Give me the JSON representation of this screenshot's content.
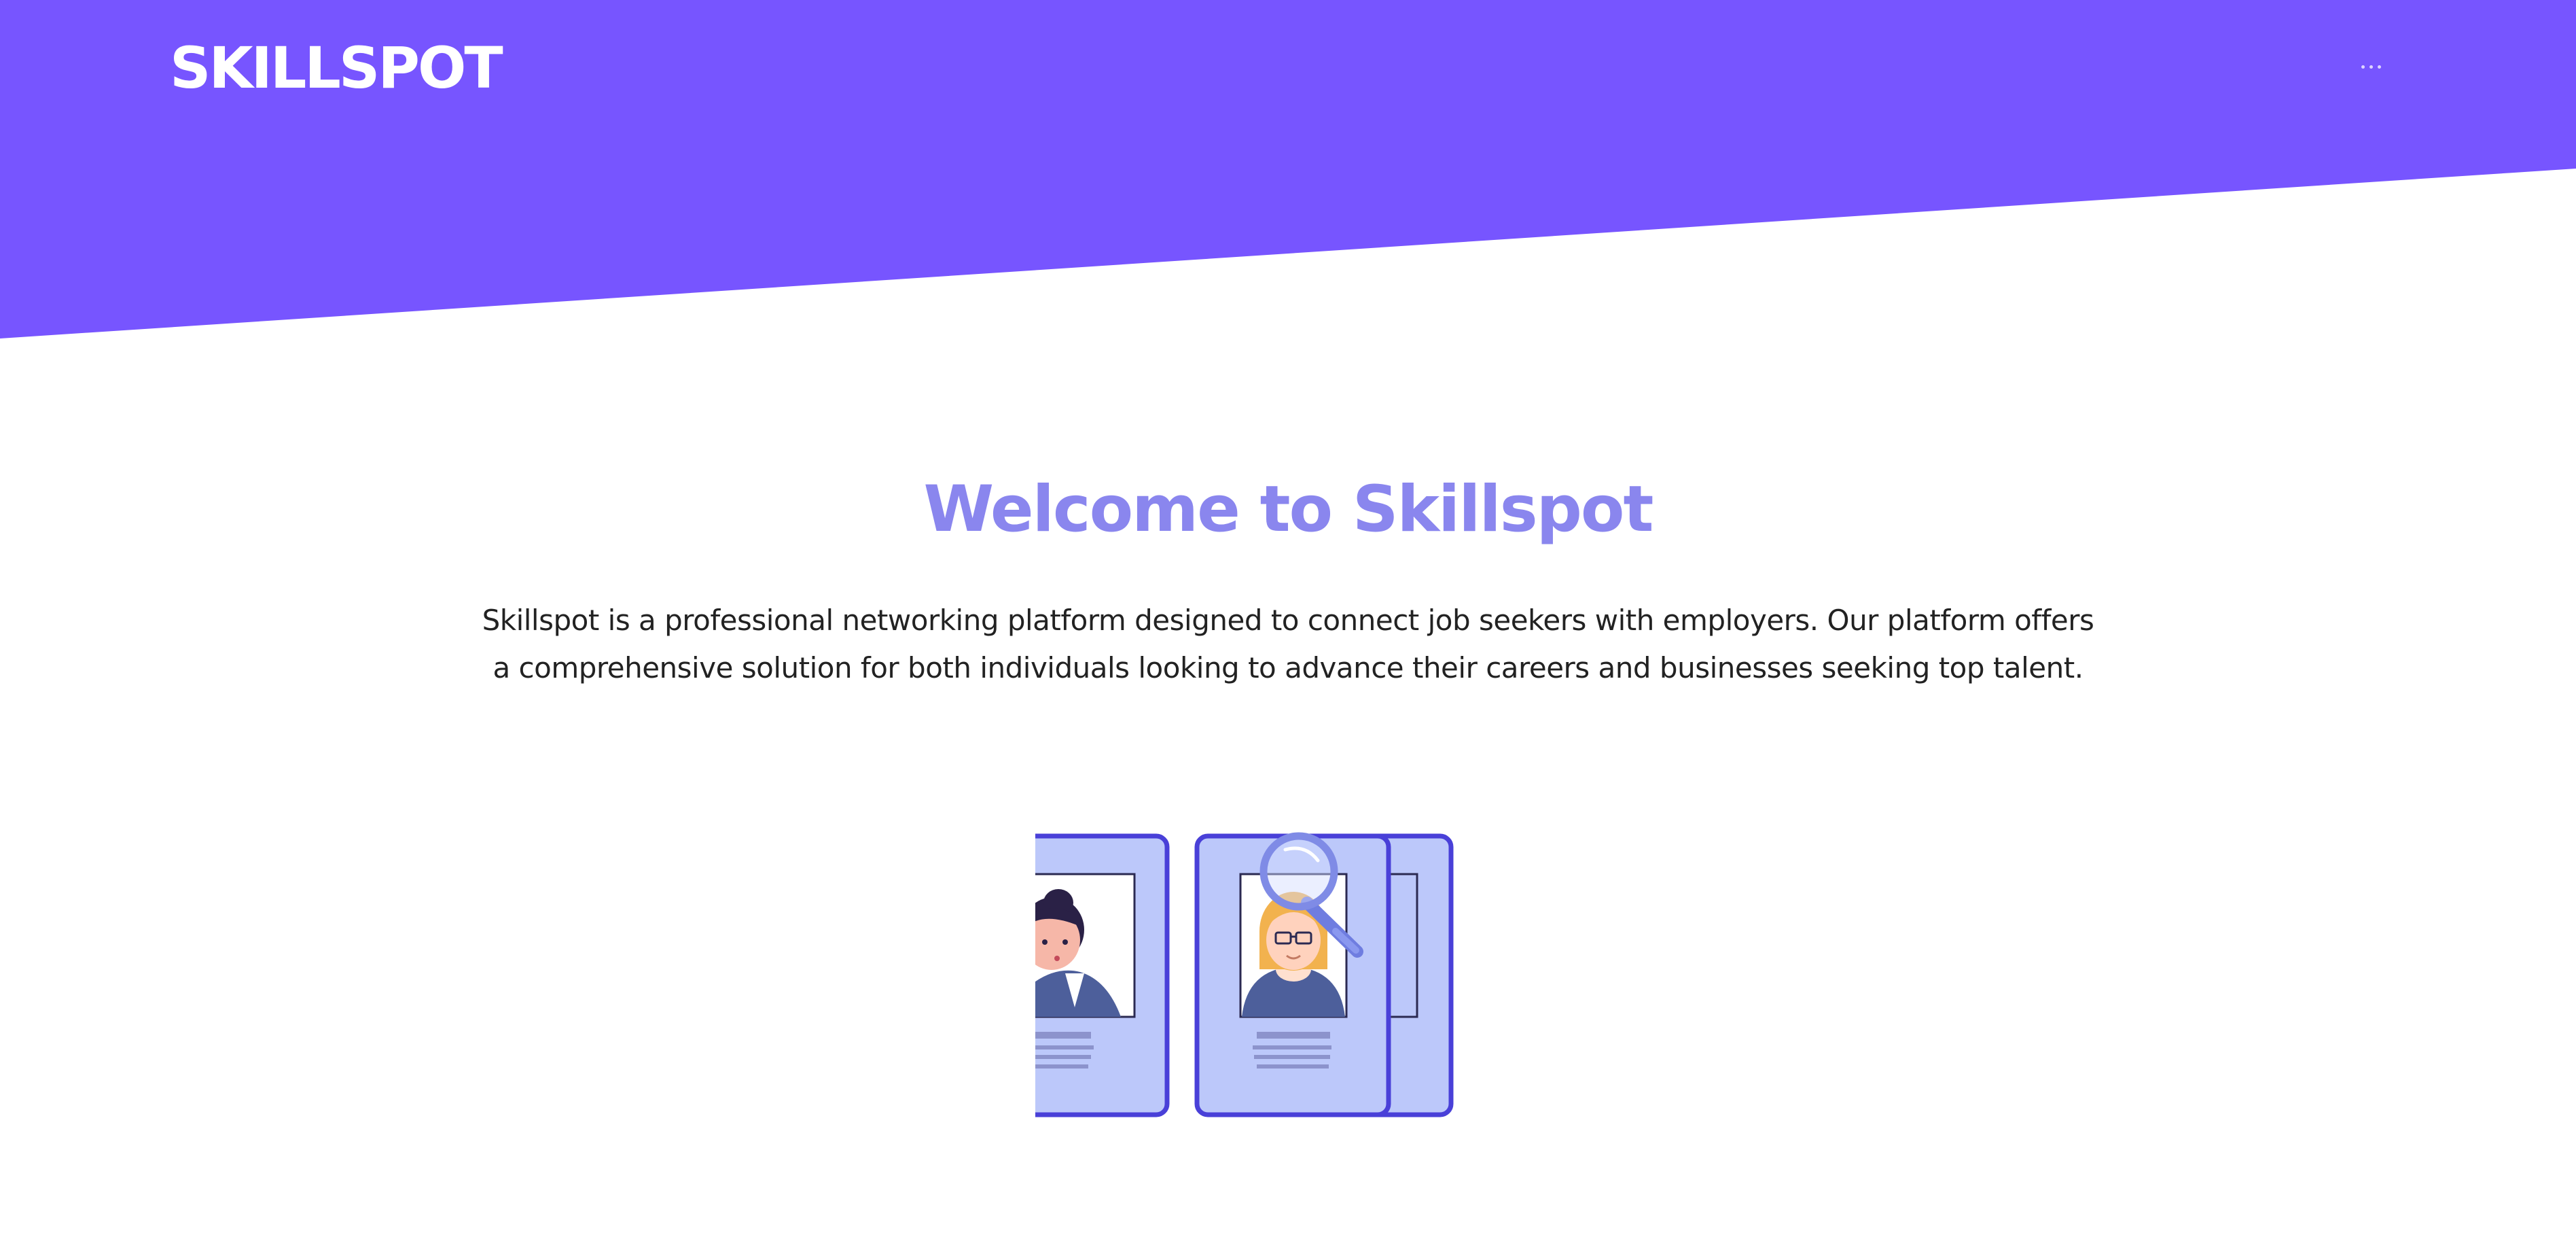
{
  "header": {
    "logo": "SKILLSPOT",
    "menu_icon": "ellipsis-icon",
    "brand_color": "#7755ff"
  },
  "main": {
    "title": "Welcome to Skillspot",
    "description": "Skillspot is a professional networking platform designed to connect job seekers with employers. Our platform offers a comprehensive solution for both individuals looking to advance their careers and businesses seeking top talent.",
    "title_color": "#8a86ee"
  },
  "illustration": {
    "icons": [
      "profile-card-icon",
      "magnifier-icon"
    ]
  }
}
